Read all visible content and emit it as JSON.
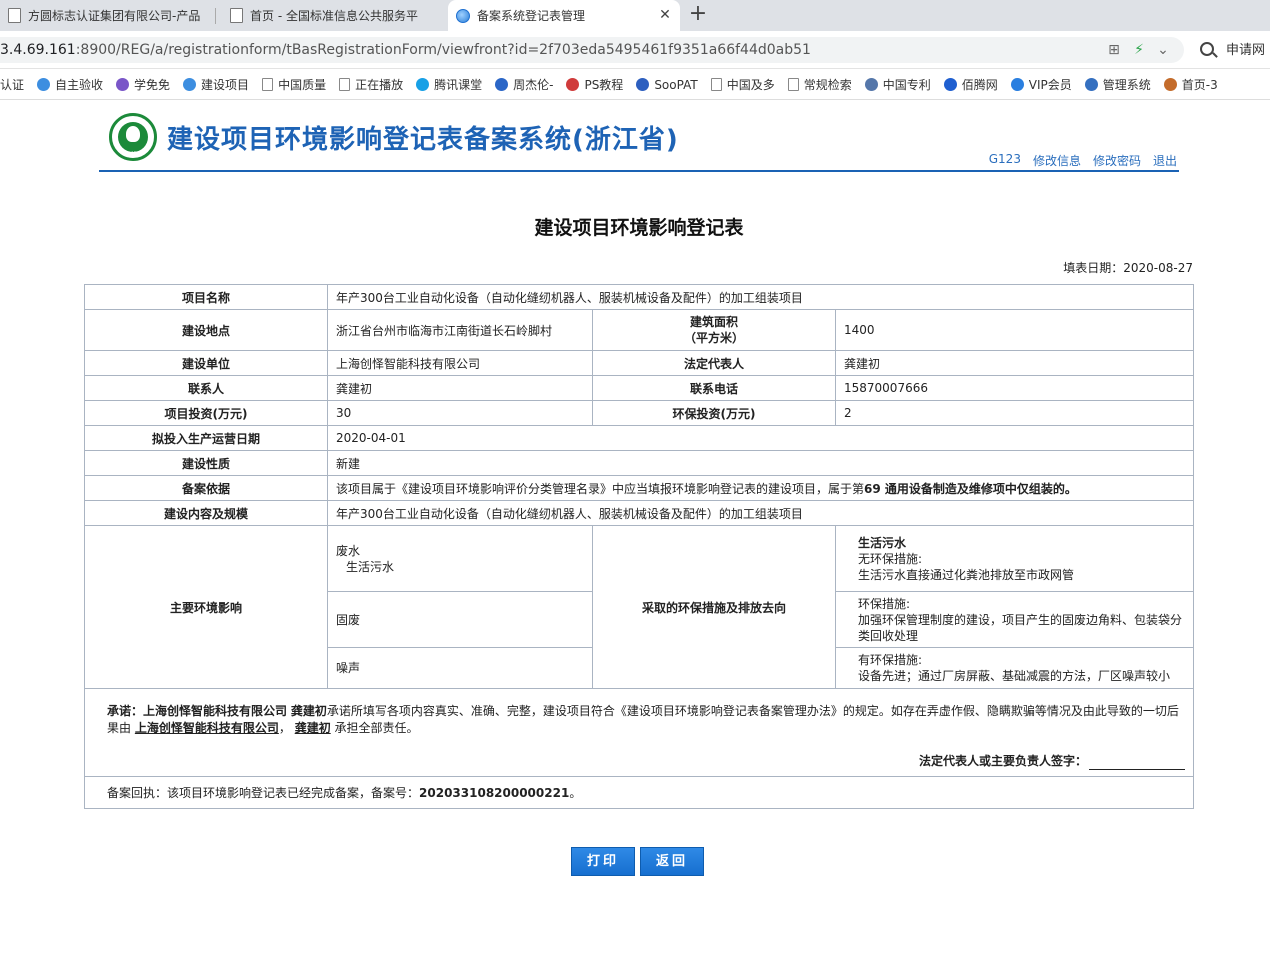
{
  "browser": {
    "tabs": [
      {
        "title": "方圆标志认证集团有限公司-产品",
        "active": false
      },
      {
        "title": "首页 - 全国标准信息公共服务平",
        "active": false
      },
      {
        "title": "备案系统登记表管理",
        "active": true
      }
    ],
    "url_host": "3.4.69.161",
    "url_rest": ":8900/REG/a/registrationform/tBasRegistrationForm/viewfront?id=2f703eda5495461f9351a66f44d0ab51",
    "search_label": "申请网",
    "bookmarks": [
      {
        "label": "认证",
        "icon": "none"
      },
      {
        "label": "自主验收",
        "icon": "globe-icon"
      },
      {
        "label": "学免免",
        "icon": "logo-icon"
      },
      {
        "label": "建设项目",
        "icon": "globe-icon"
      },
      {
        "label": "中国质量",
        "icon": "page-icon"
      },
      {
        "label": "正在播放",
        "icon": "page-icon"
      },
      {
        "label": "腾讯课堂",
        "icon": "diamond-icon"
      },
      {
        "label": "周杰伦-",
        "icon": "circle-icon"
      },
      {
        "label": "PS教程",
        "icon": "ps-icon"
      },
      {
        "label": "SooPAT",
        "icon": "link-icon"
      },
      {
        "label": "中国及多",
        "icon": "page-icon"
      },
      {
        "label": "常规检索",
        "icon": "page-icon"
      },
      {
        "label": "中国专利",
        "icon": "doc-icon"
      },
      {
        "label": "佰腾网",
        "icon": "b-icon"
      },
      {
        "label": "VIP会员",
        "icon": "v-icon"
      },
      {
        "label": "管理系统",
        "icon": "gear-icon"
      },
      {
        "label": "首页-3",
        "icon": "cake-icon"
      }
    ]
  },
  "header": {
    "logo_text": "ZHB",
    "title": "建设项目环境影响登记表备案系统(浙江省)",
    "links": [
      "G123",
      "修改信息",
      "修改密码",
      "退出"
    ]
  },
  "form": {
    "title": "建设项目环境影响登记表",
    "fill_date_label": "填表日期：",
    "fill_date": "2020-08-27",
    "labels": {
      "project_name": "项目名称",
      "location": "建设地点",
      "area": "建筑面积",
      "area_unit": "（平方米）",
      "unit": "建设单位",
      "legal_rep": "法定代表人",
      "contact": "联系人",
      "phone": "联系电话",
      "investment": "项目投资(万元)",
      "env_investment": "环保投资(万元)",
      "start_date": "拟投入生产运营日期",
      "nature": "建设性质",
      "basis": "备案依据",
      "content": "建设内容及规模",
      "impacts": "主要环境影响",
      "measures": "采取的环保措施及排放去向"
    },
    "values": {
      "project_name": "年产300台工业自动化设备（自动化缝纫机器人、服装机械设备及配件）的加工组装项目",
      "location": "浙江省台州市临海市江南街道长石岭脚村",
      "area": "1400",
      "unit": "上海创怿智能科技有限公司",
      "legal_rep": "龚建初",
      "contact": "龚建初",
      "phone": "15870007666",
      "investment": "30",
      "env_investment": "2",
      "start_date": "2020-04-01",
      "nature": "新建",
      "basis_prefix": "该项目属于《建设项目环境影响评价分类管理名录》中应当填报环境影响登记表的建设项目，属于第",
      "basis_bold": "69 通用设备制造及维修项中仅组装的。",
      "content": "年产300台工业自动化设备（自动化缝纫机器人、服装机械设备及配件）的加工组装项目"
    },
    "impacts": [
      {
        "type": "废水",
        "sub": "生活污水",
        "measure_title": "生活污水",
        "measure_label": "无环保措施:",
        "measure_text": "生活污水直接通过化粪池排放至市政网管"
      },
      {
        "type": "固废",
        "sub": "",
        "measure_title": "",
        "measure_label": "环保措施:",
        "measure_text": "加强环保管理制度的建设，项目产生的固废边角料、包装袋分类回收处理"
      },
      {
        "type": "噪声",
        "sub": "",
        "measure_title": "",
        "measure_label": "有环保措施:",
        "measure_text": "设备先进；通过厂房屏蔽、基础减震的方法，厂区噪声较小"
      }
    ],
    "promise": {
      "label": "承诺：",
      "company": "上海创怿智能科技有限公司",
      "person": "龚建初",
      "text1": "承诺所填写各项内容真实、准确、完整，建设项目符合《建设项目环境影响登记表备案管理办法》的规定。如存在弄虚作假、隐瞒欺骗等情况及由此导致的一切后果由",
      "text2": "承担全部责任。",
      "sign_label": "法定代表人或主要负责人签字："
    },
    "receipt": {
      "text": "备案回执：该项目环境影响登记表已经完成备案，备案号：",
      "number": "202033108200000221",
      "suffix": "。"
    }
  },
  "buttons": {
    "print": "打印",
    "back": "返回"
  }
}
